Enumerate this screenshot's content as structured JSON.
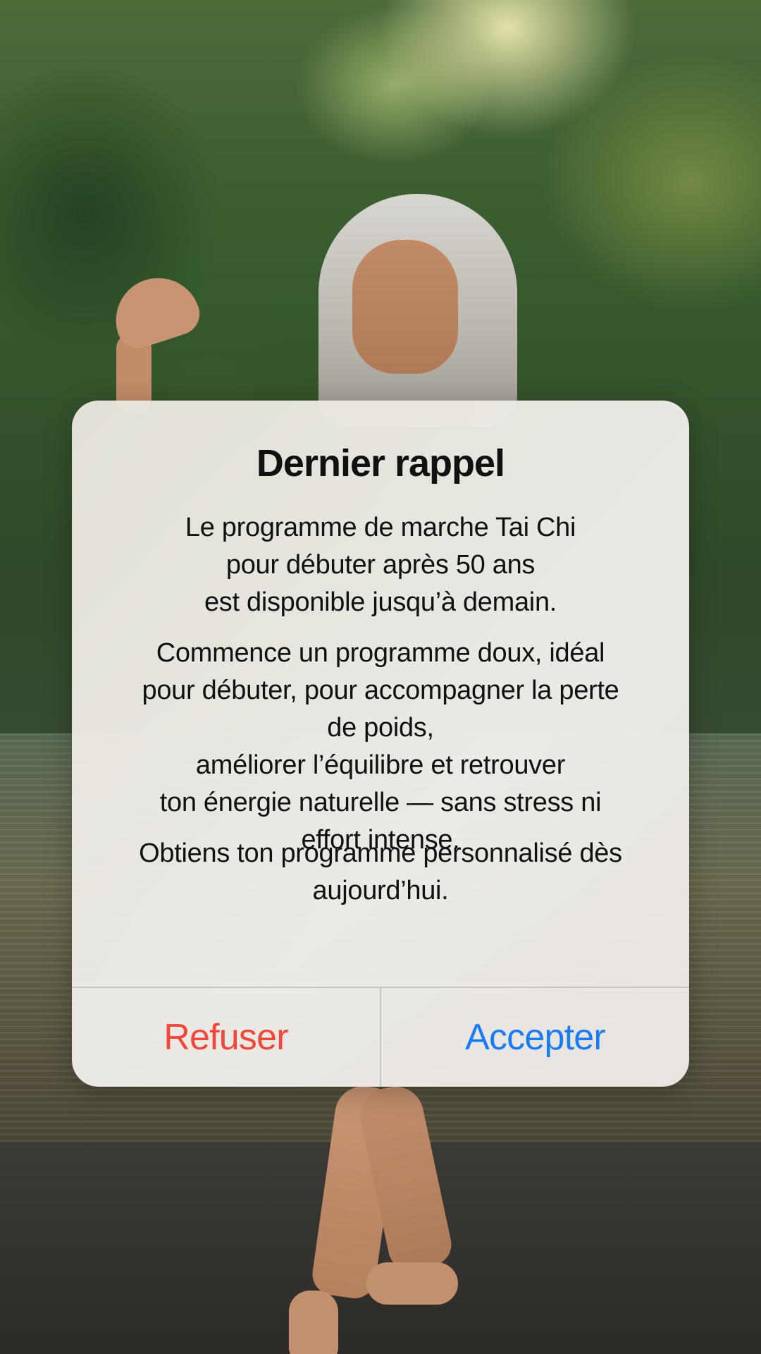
{
  "dialog": {
    "title": "Dernier rappel",
    "paragraph_1": [
      "Le programme de marche Tai Chi",
      "pour débuter après 50 ans",
      "est disponible jusqu’à demain."
    ],
    "paragraph_2": [
      "Commence un programme doux, idéal",
      "pour débuter, pour accompagner la perte",
      "de poids,",
      "améliorer l’équilibre et retrouver",
      "ton énergie naturelle — sans stress ni",
      "effort intense."
    ],
    "paragraph_3": [
      "Obtiens ton programme personnalisé dès",
      "aujourd’hui."
    ],
    "refuse_label": "Refuser",
    "accept_label": "Accepter"
  },
  "colors": {
    "refuse": "#f0473d",
    "accept": "#1a7cf2",
    "dialog_background": "#ebe8e2"
  }
}
